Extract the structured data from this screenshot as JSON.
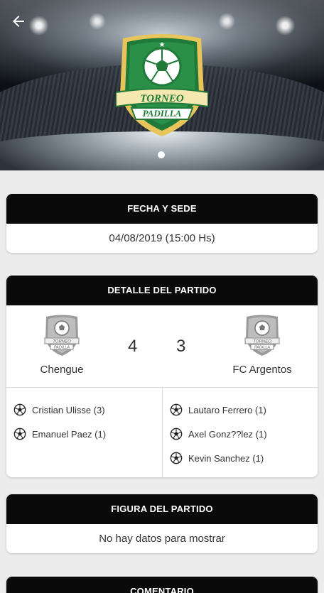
{
  "header": {
    "logo": {
      "line1": "TORNEO",
      "line2": "PADILLA"
    }
  },
  "fecha": {
    "title": "FECHA Y SEDE",
    "value": "04/08/2019 (15:00 Hs)"
  },
  "detalle": {
    "title": "DETALLE DEL PARTIDO",
    "home": {
      "name": "Chengue",
      "score": "4",
      "crest_text": [
        "TORNEO",
        "PADILLA"
      ]
    },
    "away": {
      "name": "FC Argentos",
      "score": "3",
      "crest_text": [
        "TORNEO",
        "PADILLA"
      ]
    },
    "home_scorers": [
      "Cristian Ulisse (3)",
      "Emanuel Paez (1)"
    ],
    "away_scorers": [
      "Lautaro Ferrero (1)",
      "Axel Gonz??lez (1)",
      "Kevin Sanchez (1)"
    ]
  },
  "figura": {
    "title": "FIGURA DEL PARTIDO",
    "value": "No hay datos para mostrar"
  },
  "comentario": {
    "title": "COMENTARIO"
  },
  "icons": {
    "back": "arrow-left-icon",
    "goal": "soccer-ball-icon"
  },
  "colors": {
    "card_header": "#0a0a0a",
    "logo_green": "#1f7a3a",
    "logo_gold": "#e8c55a"
  }
}
